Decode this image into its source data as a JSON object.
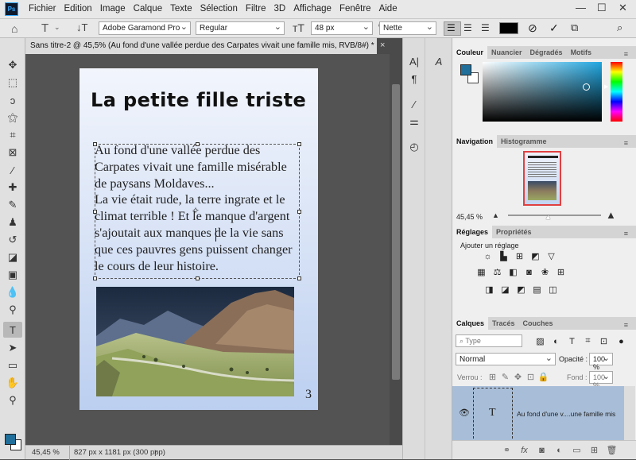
{
  "app": {
    "logo": "Ps"
  },
  "menu": [
    "Fichier",
    "Edition",
    "Image",
    "Calque",
    "Texte",
    "Sélection",
    "Filtre",
    "3D",
    "Affichage",
    "Fenêtre",
    "Aide"
  ],
  "window_controls": {
    "minimize": "—",
    "maximize": "☐",
    "close": "✕"
  },
  "options": {
    "font_family": "Adobe Garamond Pro",
    "font_style": "Regular",
    "font_size": "48 px",
    "antialias": "Nette",
    "text_color": "#000000"
  },
  "document": {
    "tab_title": "Sans titre-2 @ 45,5% (Au fond d'une vallée perdue des Carpates vivait une famille mis, RVB/8#) *",
    "close": "×",
    "zoom": "45,45 %",
    "size_info": "827 px x 1181 px (300 ppp)"
  },
  "page": {
    "title": "La petite fille triste",
    "lines": [
      "Au fond d'une vallée perdue des",
      "Carpates vivait une famille misérable",
      "de paysans Moldaves...",
      "La vie était rude, la terre ingrate et le",
      "climat terrible ! Et le manque d'argent",
      "s'ajoutait aux manques de la vie sans",
      "que ces pauvres gens puissent changer",
      "le cours de leur histoire."
    ],
    "page_number": "3"
  },
  "color_panel": {
    "tabs": [
      "Couleur",
      "Nuancier",
      "Dégradés",
      "Motifs"
    ],
    "foreground": "#1f6f9a",
    "background": "#ffffff"
  },
  "navigation_panel": {
    "tabs": [
      "Navigation",
      "Histogramme"
    ],
    "zoom": "45,45 %"
  },
  "adjustments_panel": {
    "tabs": [
      "Réglages",
      "Propriétés"
    ],
    "add_label": "Ajouter un réglage"
  },
  "layers_panel": {
    "tabs": [
      "Calques",
      "Tracés",
      "Couches"
    ],
    "filter_kind": "Type",
    "blend_mode": "Normal",
    "opacity_label": "Opacité :",
    "opacity": "100 %",
    "lock_label": "Verrou :",
    "fill_label": "Fond :",
    "fill": "100 %",
    "layer_name": "Au fond d'une v....une famille mis",
    "layer_thumb": "T"
  }
}
